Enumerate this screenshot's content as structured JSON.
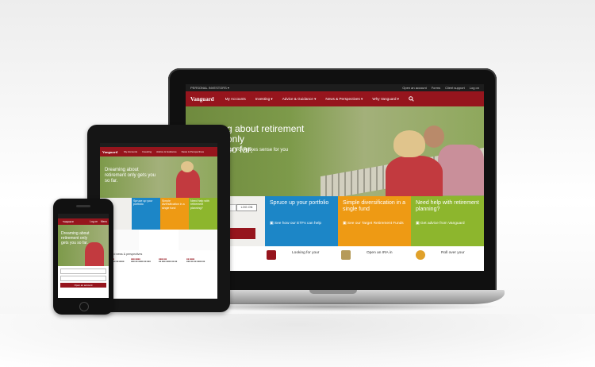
{
  "laptop_site": {
    "utility": {
      "left": "PERSONAL INVESTORS ▾",
      "links": [
        "Open an account",
        "Forms",
        "Client support",
        "Log on"
      ]
    },
    "nav": {
      "logo": "Vanguard",
      "items": [
        "My Accounts",
        "Investing ▾",
        "Advice & Guidance ▾",
        "News & Perspectives ▾",
        "Why Vanguard ▾"
      ],
      "search_icon": "search-icon"
    },
    "hero": {
      "headline": "g about retirement only\nso far.",
      "subtext": "ard IRA makes sense for you"
    },
    "login": {
      "button": "LOG ON",
      "open_account": "ount"
    },
    "tiles": [
      {
        "title": "Spruce up your portfolio",
        "link": "See how our ETFs can help",
        "color": "#1c86c7"
      },
      {
        "title": "Simple diversification in a single fund",
        "link": "See our Target Retirement Funds",
        "color": "#ee9a14"
      },
      {
        "title": "Need help with retirement planning?",
        "link": "Get advice from Vanguard",
        "color": "#8db62d"
      }
    ],
    "strip": [
      "ice with",
      "Looking for your",
      "Open an IRA in",
      "Roll over your"
    ]
  },
  "tablet_site": {
    "logo": "Vanguard",
    "nav_items": [
      "My Accounts",
      "Investing",
      "Advice & Guidance",
      "News & Perspectives",
      "Why Vanguard"
    ],
    "headline": "Dreaming about retirement only gets you so far.",
    "tiles": [
      "Spruce up your portfolio",
      "Simple diversification in a single fund",
      "Need help with retirement planning?"
    ],
    "section_title": "Vanguard news & perspectives"
  },
  "phone_site": {
    "logo": "Vanguard",
    "nav_items": [
      "Log on",
      "Menu"
    ],
    "headline": "Dreaming about retirement only gets you so far.",
    "open_button": "Open an account"
  },
  "colors": {
    "brand_red": "#96151d",
    "blue": "#1c86c7",
    "orange": "#ee9a14",
    "green": "#8db62d"
  }
}
